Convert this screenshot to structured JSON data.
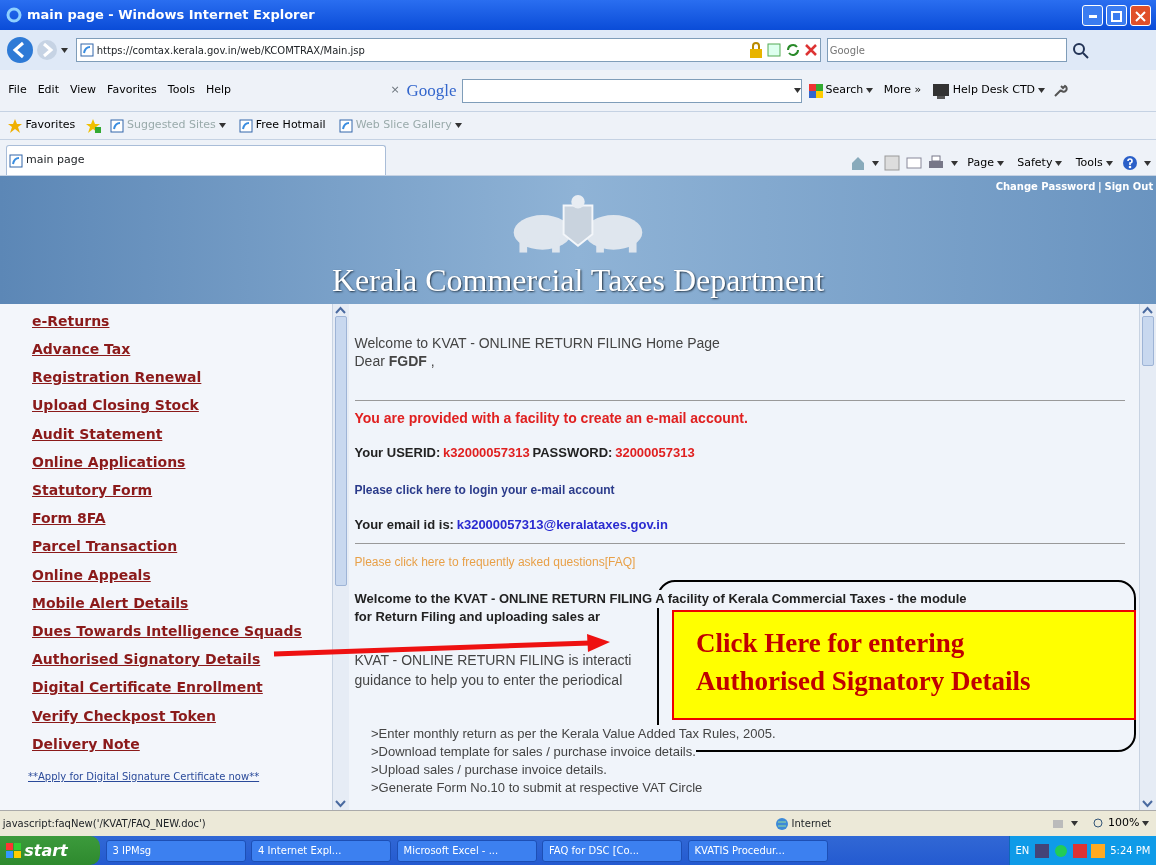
{
  "window": {
    "title": "main page - Windows Internet Explorer"
  },
  "address_bar": {
    "url": "https://comtax.kerala.gov.in/web/KCOMTRAX/Main.jsp",
    "search_placeholder": "Google"
  },
  "menu": [
    "File",
    "Edit",
    "View",
    "Favorites",
    "Tools",
    "Help"
  ],
  "google_toolbar": {
    "close": "×",
    "logo": "Google",
    "search_button": "Search",
    "more": "More »",
    "help_desk": "Help Desk CTD"
  },
  "favorites_bar": [
    {
      "label": "Favorites",
      "kind": "star",
      "disabled": false,
      "dropdown": false
    },
    {
      "label": "Suggested Sites",
      "kind": "page",
      "disabled": true,
      "dropdown": true
    },
    {
      "label": "Free Hotmail",
      "kind": "page",
      "disabled": false,
      "dropdown": false
    },
    {
      "label": "Web Slice Gallery",
      "kind": "page",
      "disabled": true,
      "dropdown": true
    }
  ],
  "tab": {
    "label": "main page"
  },
  "command_bar": [
    "Page",
    "Safety",
    "Tools"
  ],
  "banner": {
    "links": [
      "Change Password",
      "Sign Out"
    ],
    "separator": "|",
    "title": "Kerala Commercial Taxes Department"
  },
  "sidebar": {
    "items": [
      "e-Returns",
      "Advance Tax",
      "Registration Renewal",
      "Upload Closing Stock",
      "Audit Statement",
      "Online Applications",
      "Statutory Form",
      "Form 8FA",
      "Parcel Transaction",
      "Online Appeals",
      "Mobile Alert Details",
      "Dues Towards Intelligence Squads",
      "Authorised Signatory Details",
      "Digital Certificate Enrollment",
      "Verify Checkpost Token",
      "Delivery Note"
    ],
    "footer_link": "**Apply for Digital Signature Certificate now**"
  },
  "main": {
    "welcome": "Welcome to KVAT - ONLINE RETURN FILING Home Page",
    "greeting": "Dear **FGDF** ,",
    "notice": "You are provided with a facility to create an e-mail account.",
    "credentials": [
      {
        "label": "Your USERID:",
        "value": "k32000057313"
      },
      {
        "label": "PASSWORD:",
        "value": "32000057313"
      }
    ],
    "login_link": "Please click here to login your e-mail account",
    "email": {
      "label": "Your email id is:",
      "value": "k32000057313@keralataxes.gov.in"
    },
    "faq_link": "Please click here to frequently asked questions[FAQ]",
    "intro_lines": [
      "Welcome to the KVAT - ONLINE RETURN FILING A facility of Kerala Commercial Taxes - the module",
      "for Return Filing and uploading sales ar"
    ],
    "info_lines": [
      "KVAT - ONLINE RETURN FILING is interacti",
      "guidance to help you to enter the periodical"
    ],
    "bullets": [
      ">Enter monthly return as per the Kerala Value Added Tax Rules, 2005.",
      ">Download template for sales / purchase invoice details.",
      ">Upload sales / purchase invoice details.",
      ">Generate Form No.10 to submit at respective VAT Circle"
    ]
  },
  "callout": {
    "lines": [
      "Click Here for entering",
      "Authorised Signatory Details"
    ]
  },
  "status_bar": {
    "text": "javascript:faqNew('/KVAT/FAQ_NEW.doc')",
    "zone": "Internet",
    "zoom": "100%"
  },
  "taskbar": {
    "start": "start",
    "buttons": [
      "3 IPMsg",
      "4 Internet Expl...",
      "Microsoft Excel - ...",
      "FAQ for DSC [Co...",
      "KVATIS Procedur..."
    ],
    "language": "EN",
    "clock": "5:24 PM"
  }
}
